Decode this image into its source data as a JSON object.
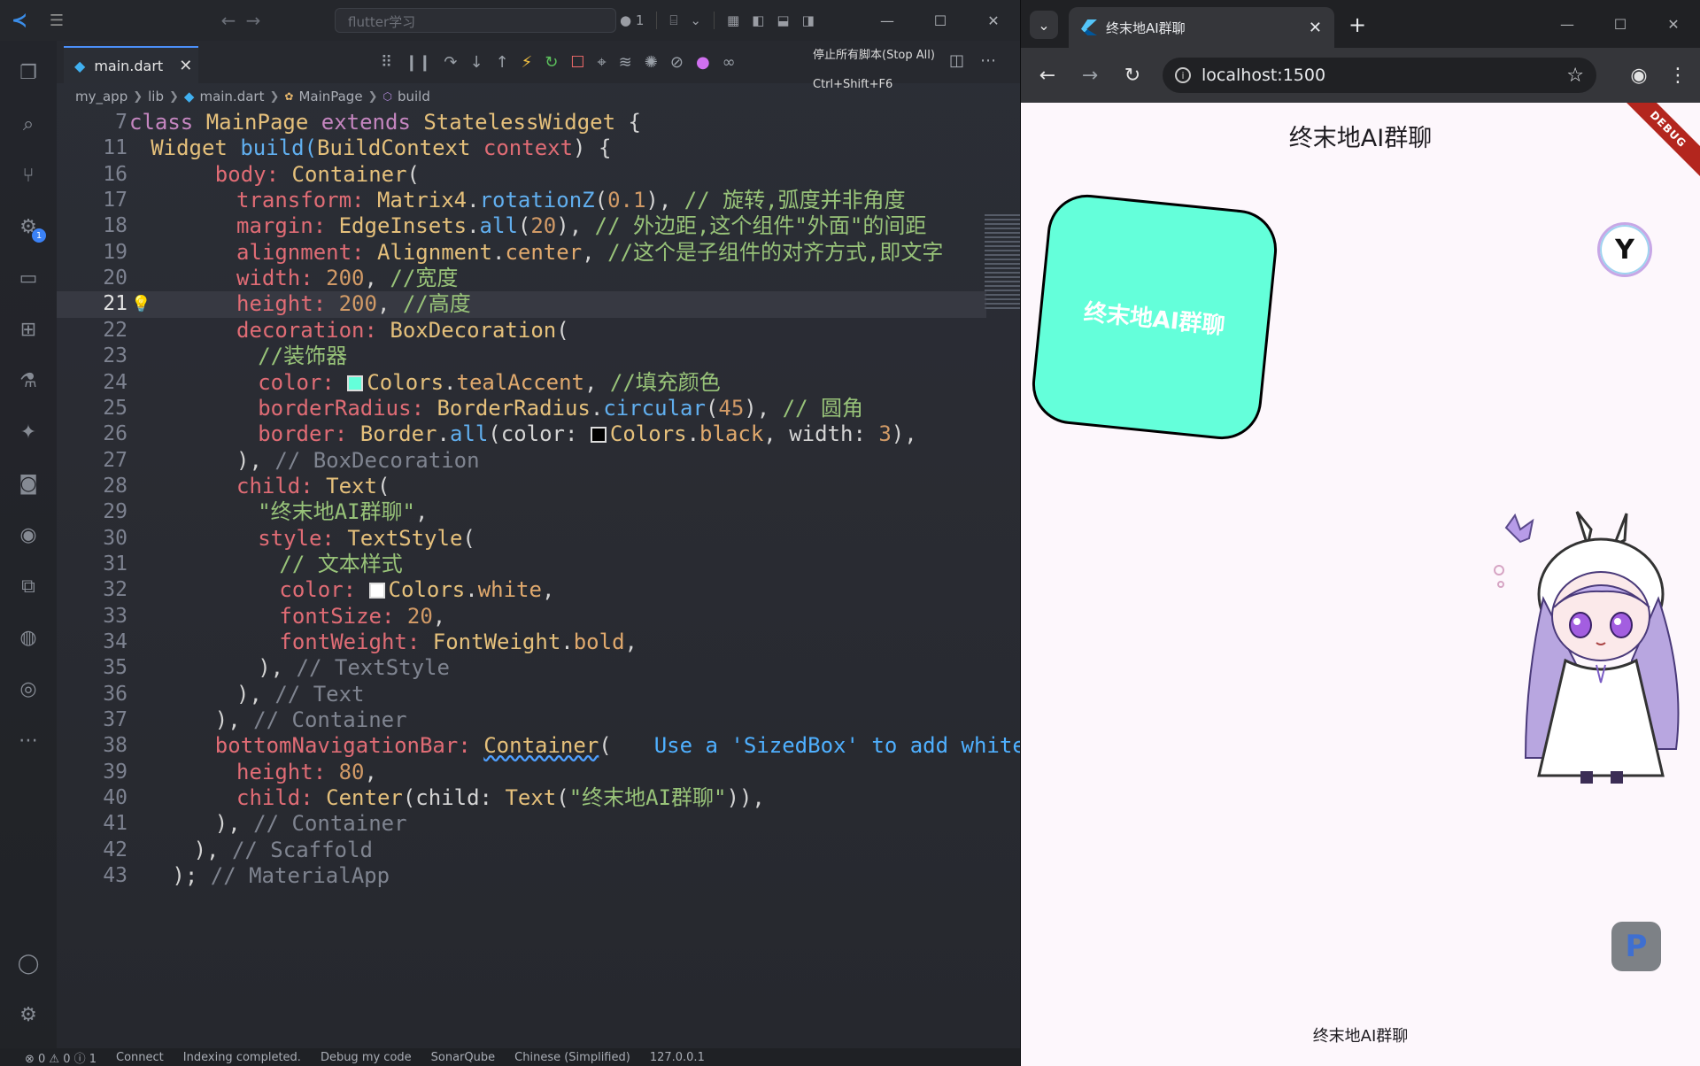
{
  "vscode": {
    "command_center_text": "flutter学习",
    "badge_count": "1",
    "title_right": {
      "dirty_count": "1"
    },
    "tab": {
      "filename": "main.dart"
    },
    "stop_all_tooltip": {
      "label": "停止所有脚本(Stop All)",
      "shortcut": "Ctrl+Shift+F6"
    },
    "breadcrumb": [
      "my_app",
      "lib",
      "main.dart",
      "MainPage",
      "build"
    ],
    "status_bar": [
      "⊗ 0 ⚠ 0 ⓘ 1",
      "Connect",
      "Indexing completed.",
      "Debug my code",
      "SonarQube",
      "Chinese (Simplified)",
      "127.0.0.1"
    ],
    "lines": [
      {
        "ln": "7"
      },
      {
        "ln": "11"
      },
      {
        "ln": "16"
      },
      {
        "ln": "17"
      },
      {
        "ln": "18"
      },
      {
        "ln": "19"
      },
      {
        "ln": "20"
      },
      {
        "ln": "21"
      },
      {
        "ln": "22"
      },
      {
        "ln": "23"
      },
      {
        "ln": "24"
      },
      {
        "ln": "25"
      },
      {
        "ln": "26"
      },
      {
        "ln": "27"
      },
      {
        "ln": "28"
      },
      {
        "ln": "29"
      },
      {
        "ln": "30"
      },
      {
        "ln": "31"
      },
      {
        "ln": "32"
      },
      {
        "ln": "33"
      },
      {
        "ln": "34"
      },
      {
        "ln": "35"
      },
      {
        "ln": "36"
      },
      {
        "ln": "37"
      },
      {
        "ln": "38"
      },
      {
        "ln": "39"
      },
      {
        "ln": "40"
      },
      {
        "ln": "41"
      },
      {
        "ln": "42"
      },
      {
        "ln": "43"
      }
    ],
    "code": {
      "l7": [
        "class",
        "MainPage",
        "extends",
        "StatelessWidget",
        "{"
      ],
      "l11": [
        "Widget",
        "build",
        "BuildContext",
        "context",
        ") {"
      ],
      "l16": [
        "body: ",
        "Container",
        "("
      ],
      "l17": [
        "transform: ",
        "Matrix4",
        ".",
        "rotationZ",
        "(",
        "0.1",
        "), ",
        "// 旋转,弧度并非角度"
      ],
      "l18": [
        "margin: ",
        "EdgeInsets",
        ".",
        "all",
        "(",
        "20",
        "), ",
        "// 外边距,这个组件\"外面\"的间距"
      ],
      "l19": [
        "alignment: ",
        "Alignment",
        ".",
        "center",
        ", ",
        "//这个是子组件的对齐方式,即文字"
      ],
      "l20": [
        "width: ",
        "200",
        ", ",
        "//宽度"
      ],
      "l21": [
        "height: ",
        "200",
        ", ",
        "//高度"
      ],
      "l22": [
        "decoration: ",
        "BoxDecoration",
        "("
      ],
      "l23": [
        "//装饰器"
      ],
      "l24": [
        "color: ",
        "Colors",
        ".",
        "tealAccent",
        ", ",
        "//填充颜色"
      ],
      "l25": [
        "borderRadius: ",
        "BorderRadius",
        ".",
        "circular",
        "(",
        "45",
        "), ",
        "// 圆角"
      ],
      "l26": [
        "border: ",
        "Border",
        ".",
        "all",
        "(color: ",
        "Colors",
        ".",
        "black",
        ", width: ",
        "3",
        "),"
      ],
      "l27": [
        "), ",
        "// BoxDecoration"
      ],
      "l28": [
        "child: ",
        "Text",
        "("
      ],
      "l29": [
        "\"终末地AI群聊\"",
        ","
      ],
      "l30": [
        "style: ",
        "TextStyle",
        "("
      ],
      "l31": [
        "// 文本样式"
      ],
      "l32": [
        "color: ",
        "Colors",
        ".",
        "white",
        ","
      ],
      "l33": [
        "fontSize: ",
        "20",
        ","
      ],
      "l34": [
        "fontWeight: ",
        "FontWeight",
        ".",
        "bold",
        ","
      ],
      "l35": [
        "), ",
        "// TextStyle"
      ],
      "l36": [
        "), ",
        "// Text"
      ],
      "l37": [
        "), ",
        "// Container"
      ],
      "l38": [
        "bottomNavigationBar: ",
        "Container",
        "(",
        "Use a 'SizedBox' to add whitespace"
      ],
      "l39": [
        "height: ",
        "80",
        ","
      ],
      "l40": [
        "child: ",
        "Center",
        "(child: ",
        "Text",
        "(",
        "\"终末地AI群聊\"",
        ")),"
      ],
      "l41": [
        "), ",
        "// Container"
      ],
      "l42": [
        "), ",
        "// Scaffold"
      ],
      "l43": [
        "); ",
        "// MaterialApp"
      ]
    }
  },
  "chrome": {
    "tab_title": "终末地AI群聊",
    "url": "localhost:1500"
  },
  "app": {
    "appbar_title": "终末地AI群聊",
    "debug_banner": "DEBUG",
    "box_text": "终末地AI群聊",
    "bottom_text": "终末地AI群聊",
    "p_button_label": "P",
    "colors": {
      "box_fill": "#64ffda",
      "box_border": "#000000",
      "box_text": "#ffffff",
      "page_bg": "#fdf7fc"
    }
  }
}
